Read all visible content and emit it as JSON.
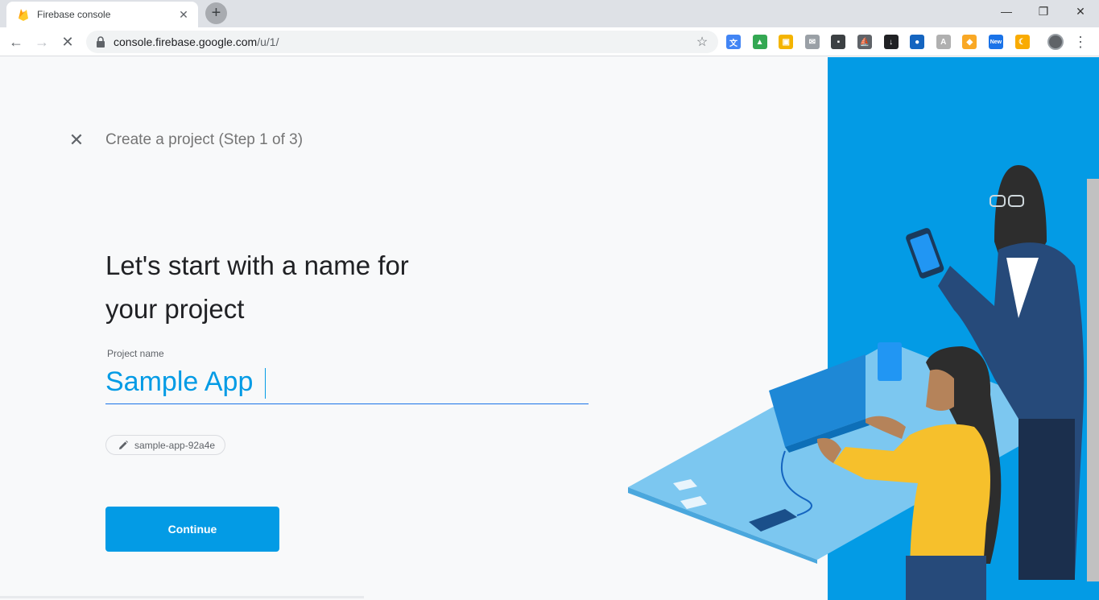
{
  "browser": {
    "tab_title": "Firebase console",
    "tab_close": "✕",
    "new_tab": "+",
    "url_host": "console.firebase.google.com",
    "url_path": "/u/1/",
    "back": "←",
    "forward": "→",
    "stop": "✕",
    "star": "☆",
    "minimize": "—",
    "restore": "❐",
    "close": "✕",
    "menu": "⋮",
    "extensions": [
      {
        "name": "translate-extension-icon",
        "color": "#4285f4",
        "glyph": "文"
      },
      {
        "name": "drive-extension-icon",
        "color": "#34a853",
        "glyph": "▲"
      },
      {
        "name": "yellow-extension-icon",
        "color": "#f4b400",
        "glyph": "▣"
      },
      {
        "name": "mail-extension-icon",
        "color": "#9aa0a6",
        "glyph": "✉"
      },
      {
        "name": "dark-extension-icon",
        "color": "#3c4043",
        "glyph": "▪"
      },
      {
        "name": "ship-extension-icon",
        "color": "#5f6368",
        "glyph": "⛵"
      },
      {
        "name": "download-extension-icon",
        "color": "#202124",
        "glyph": "↓"
      },
      {
        "name": "chat-extension-icon",
        "color": "#1565c0",
        "glyph": "●"
      },
      {
        "name": "angular-extension-icon",
        "color": "#b0b0b0",
        "glyph": "A"
      },
      {
        "name": "cat-extension-icon",
        "color": "#f9a825",
        "glyph": "◆"
      },
      {
        "name": "new-extension-icon",
        "color": "#1a73e8",
        "glyph": "New"
      },
      {
        "name": "moon-extension-icon",
        "color": "#f9ab00",
        "glyph": "☾"
      }
    ]
  },
  "page": {
    "close_icon": "✕",
    "step_title": "Create a project (Step 1 of 3)",
    "heading_line1": "Let's start with a name for",
    "heading_line2": "your project",
    "field_label": "Project name",
    "field_value": "Sample App",
    "project_id": "sample-app-92a4e",
    "continue_label": "Continue"
  },
  "colors": {
    "accent": "#039be5",
    "panel": "#039be5",
    "text": "#202124"
  }
}
